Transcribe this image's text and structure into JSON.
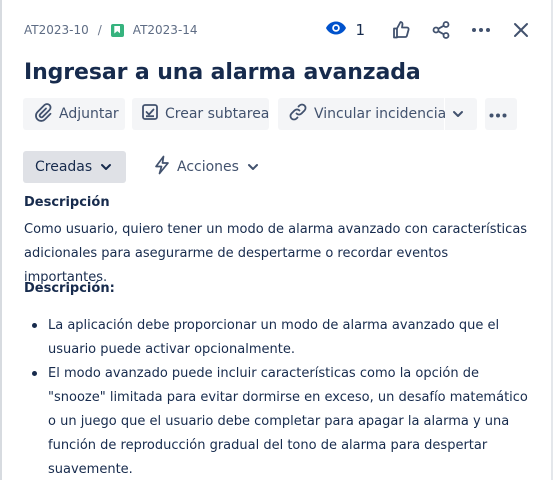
{
  "breadcrumb": {
    "parent_key": "AT2023-10",
    "separator": "/",
    "issue_key": "AT2023-14"
  },
  "header": {
    "watchers_count": "1"
  },
  "issue": {
    "title": "Ingresar a una alarma avanzada"
  },
  "toolbar": {
    "attach_label": "Adjuntar",
    "subtask_label": "Crear subtarea",
    "link_label": "Vincular incidencia"
  },
  "filters": {
    "created_label": "Creadas",
    "actions_label": "Acciones"
  },
  "description": {
    "section_label": "Descripción",
    "summary": "Como usuario, quiero tener un modo de alarma avanzado con características adicionales para asegurarme de despertarme o recordar eventos importantes.",
    "heading": "Descripción:",
    "bullets": [
      "La aplicación debe proporcionar un modo de alarma avanzado que el usuario puede activar opcionalmente.",
      "El modo avanzado puede incluir características como la opción de \"snooze\" limitada para evitar dormirse en exceso, un desafío matemático o un juego que el usuario debe completar para apagar la alarma y una función de reproducción gradual del tono de alarma para despertar suavemente."
    ]
  },
  "icons": {
    "issue_type": "story-icon",
    "watch": "eye-icon",
    "like": "thumbs-up-icon",
    "share": "share-icon",
    "more": "more-icon",
    "close": "close-icon"
  },
  "colors": {
    "story": "#36b37e",
    "watch": "#0052cc",
    "text": "#172b4d",
    "muted": "#5e6c84",
    "button_bg": "#f4f5f7"
  }
}
